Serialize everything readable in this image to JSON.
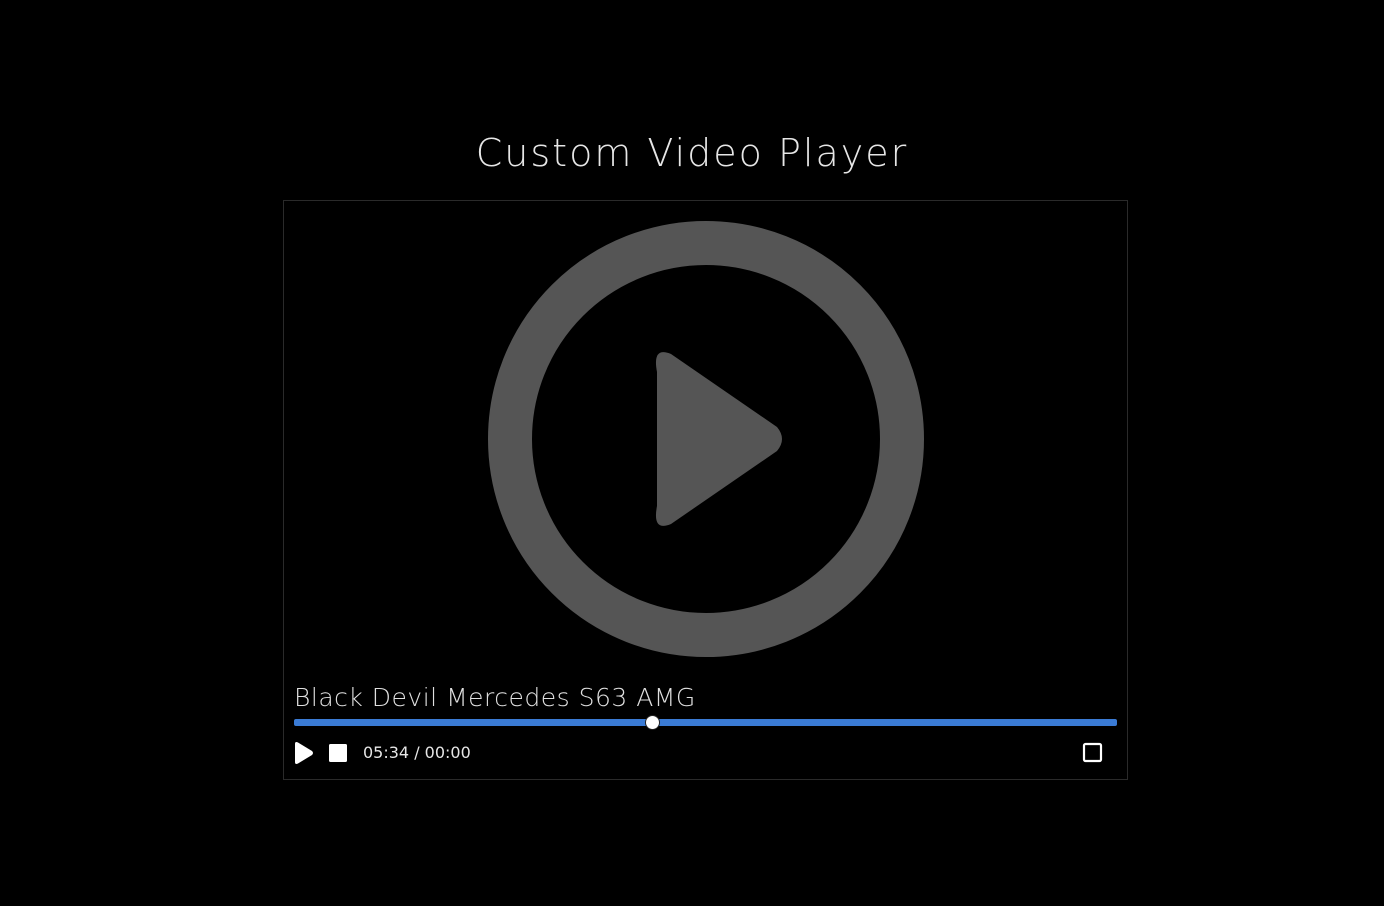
{
  "page": {
    "title": "Custom Video Player"
  },
  "player": {
    "video_title": "Black Devil Mercedes S63 AMG",
    "progress_fraction": 0.435,
    "time_display": "05:34 / 00:00",
    "colors": {
      "progress": "#3a7bd5",
      "overlay_icon": "#555555",
      "controls": "#ffffff"
    },
    "icons": {
      "big_play": "play-circle-icon",
      "play": "play-icon",
      "stop": "stop-icon",
      "fullscreen": "fullscreen-icon"
    }
  }
}
